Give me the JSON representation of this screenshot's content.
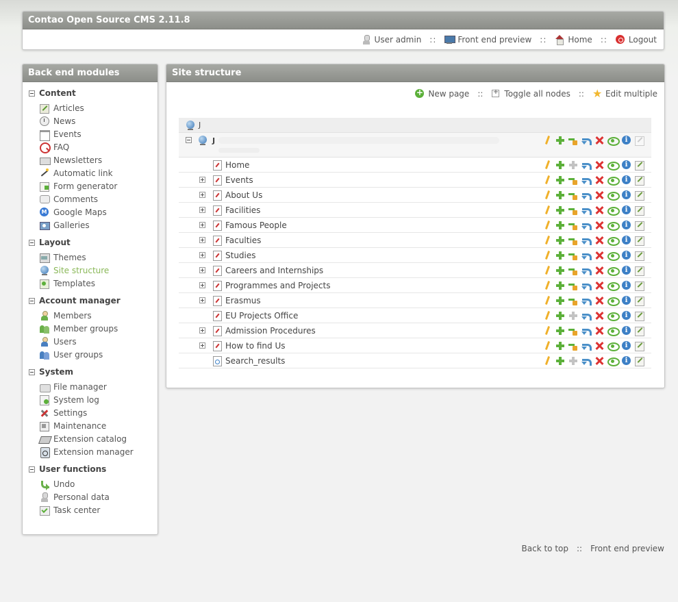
{
  "header": {
    "title": "Contao Open Source CMS 2.11.8",
    "user_label": "User admin",
    "preview_label": "Front end preview",
    "home_label": "Home",
    "logout_label": "Logout",
    "separator": "::"
  },
  "sidebar": {
    "title": "Back end modules",
    "groups": [
      {
        "title": "Content",
        "items": [
          {
            "label": "Articles",
            "icon": "article-icon"
          },
          {
            "label": "News",
            "icon": "news-icon"
          },
          {
            "label": "Events",
            "icon": "calendar-icon"
          },
          {
            "label": "FAQ",
            "icon": "faq-icon"
          },
          {
            "label": "Newsletters",
            "icon": "newsletter-icon"
          },
          {
            "label": "Automatic link",
            "icon": "magic-wand-icon"
          },
          {
            "label": "Form generator",
            "icon": "form-icon"
          },
          {
            "label": "Comments",
            "icon": "comment-icon"
          },
          {
            "label": "Google Maps",
            "icon": "google-maps-icon"
          },
          {
            "label": "Galleries",
            "icon": "gallery-icon"
          }
        ]
      },
      {
        "title": "Layout",
        "items": [
          {
            "label": "Themes",
            "icon": "themes-icon"
          },
          {
            "label": "Site structure",
            "icon": "globe-icon",
            "active": true
          },
          {
            "label": "Templates",
            "icon": "templates-icon"
          }
        ]
      },
      {
        "title": "Account manager",
        "items": [
          {
            "label": "Members",
            "icon": "member-icon"
          },
          {
            "label": "Member groups",
            "icon": "member-groups-icon"
          },
          {
            "label": "Users",
            "icon": "user-icon"
          },
          {
            "label": "User groups",
            "icon": "user-groups-icon"
          }
        ]
      },
      {
        "title": "System",
        "items": [
          {
            "label": "File manager",
            "icon": "file-manager-icon"
          },
          {
            "label": "System log",
            "icon": "system-log-icon"
          },
          {
            "label": "Settings",
            "icon": "settings-icon"
          },
          {
            "label": "Maintenance",
            "icon": "maintenance-icon"
          },
          {
            "label": "Extension catalog",
            "icon": "extension-catalog-icon"
          },
          {
            "label": "Extension manager",
            "icon": "extension-manager-icon"
          }
        ]
      },
      {
        "title": "User functions",
        "items": [
          {
            "label": "Undo",
            "icon": "undo-icon"
          },
          {
            "label": "Personal data",
            "icon": "personal-data-icon"
          },
          {
            "label": "Task center",
            "icon": "task-center-icon"
          }
        ]
      }
    ]
  },
  "main": {
    "title": "Site structure",
    "toolbar": {
      "new_page": "New page",
      "toggle_nodes": "Toggle all nodes",
      "edit_multiple": "Edit multiple",
      "separator": "::"
    },
    "tree": {
      "root_label": "J",
      "site_label": "J",
      "pages": [
        {
          "name": "Home",
          "expandable": false,
          "icon": "page-icon"
        },
        {
          "name": "Events",
          "expandable": true,
          "icon": "page-icon"
        },
        {
          "name": "About Us",
          "expandable": true,
          "icon": "page-icon"
        },
        {
          "name": "Facilities",
          "expandable": true,
          "icon": "page-icon"
        },
        {
          "name": "Famous People",
          "expandable": true,
          "icon": "page-icon"
        },
        {
          "name": "Faculties",
          "expandable": true,
          "icon": "page-icon"
        },
        {
          "name": "Studies",
          "expandable": true,
          "icon": "page-icon"
        },
        {
          "name": "Careers and Internships",
          "expandable": true,
          "icon": "page-icon"
        },
        {
          "name": "Programmes and Projects",
          "expandable": true,
          "icon": "page-icon"
        },
        {
          "name": "Erasmus",
          "expandable": true,
          "icon": "page-icon"
        },
        {
          "name": "EU Projects Office",
          "expandable": false,
          "icon": "page-icon"
        },
        {
          "name": "Admission Procedures",
          "expandable": true,
          "icon": "page-icon"
        },
        {
          "name": "How to find Us",
          "expandable": true,
          "icon": "page-icon"
        },
        {
          "name": "Search_results",
          "expandable": false,
          "icon": "search-page-icon"
        }
      ]
    }
  },
  "footer": {
    "back_to_top": "Back to top",
    "preview": "Front end preview",
    "separator": "::"
  }
}
